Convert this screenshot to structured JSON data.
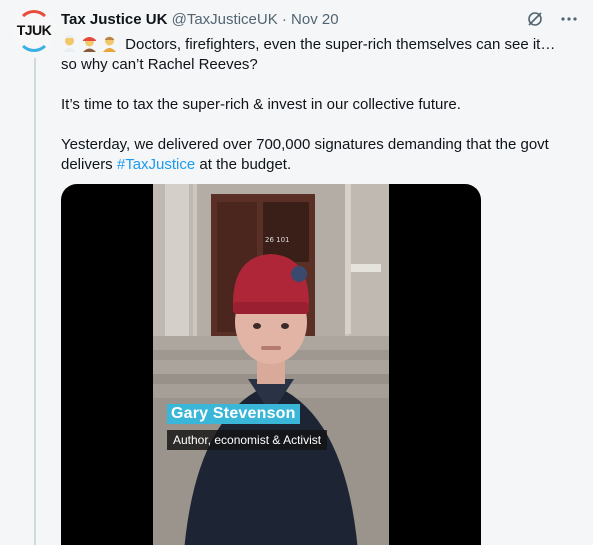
{
  "tweet": {
    "avatar_text": "TJUK",
    "author_name": "Tax Justice UK",
    "handle": "@TaxJusticeUK",
    "separator": "·",
    "date": "Nov 20",
    "emojis": [
      "health-worker-emoji",
      "firefighter-emoji",
      "person-emoji"
    ],
    "line1": "Doctors, firefighters, even the super-rich themselves can see it…",
    "line2": "so why can’t Rachel Reeves?",
    "para2": "It’s time to tax the super-rich & invest in our collective future.",
    "para3_before": "Yesterday, we delivered over 700,000 signatures demanding that the govt delivers ",
    "hashtag": "#TaxJustice",
    "para3_after": " at the budget."
  },
  "media": {
    "caption_name": "Gary Stevenson",
    "caption_role": "Author, economist & Activist",
    "door_numbers": "26 101"
  },
  "colors": {
    "accent": "#1d9bf0",
    "caption_bg": "#3ab6d8",
    "text": "#0f1419",
    "muted": "#536471"
  }
}
